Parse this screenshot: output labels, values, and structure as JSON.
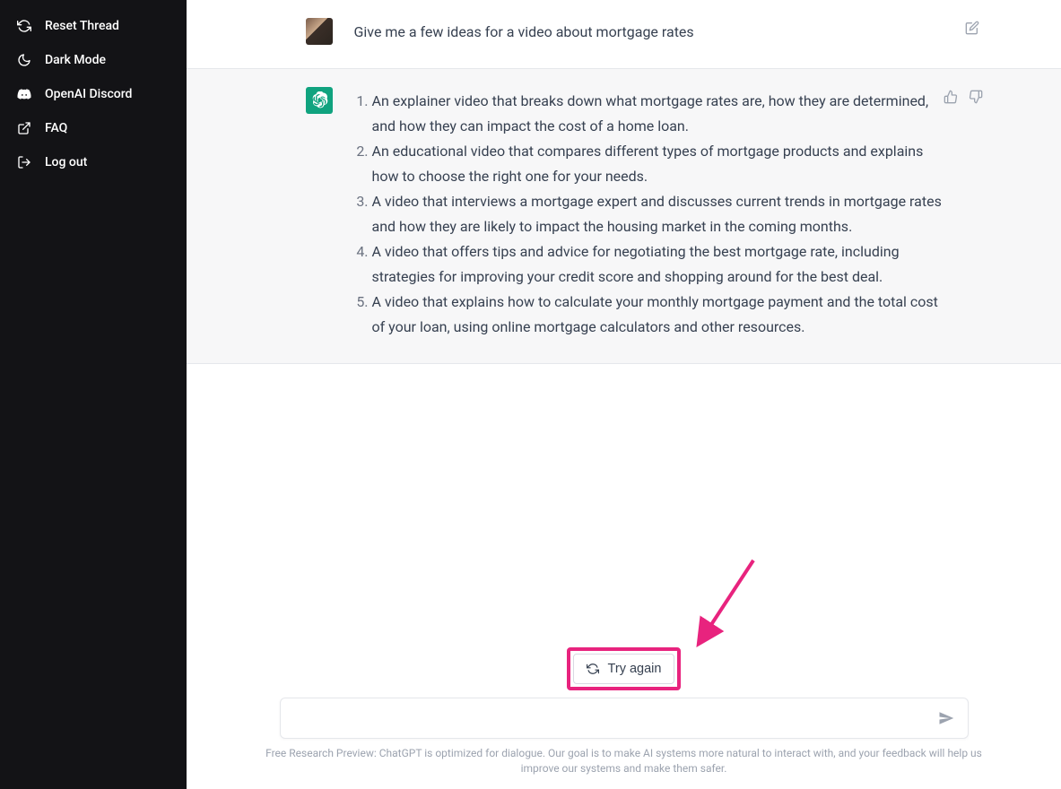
{
  "sidebar": {
    "items": [
      {
        "label": "Reset Thread"
      },
      {
        "label": "Dark Mode"
      },
      {
        "label": "OpenAI Discord"
      },
      {
        "label": "FAQ"
      },
      {
        "label": "Log out"
      }
    ]
  },
  "conversation": {
    "user_message": "Give me a few ideas for a video about mortgage rates",
    "assistant_items": [
      "An explainer video that breaks down what mortgage rates are, how they are determined, and how they can impact the cost of a home loan.",
      "An educational video that compares different types of mortgage products and explains how to choose the right one for your needs.",
      "A video that interviews a mortgage expert and discusses current trends in mortgage rates and how they are likely to impact the housing market in the coming months.",
      "A video that offers tips and advice for negotiating the best mortgage rate, including strategies for improving your credit score and shopping around for the best deal.",
      "A video that explains how to calculate your monthly mortgage payment and the total cost of your loan, using online mortgage calculators and other resources."
    ]
  },
  "footer": {
    "try_again_label": "Try again",
    "input_placeholder": "",
    "disclaimer": "Free Research Preview: ChatGPT is optimized for dialogue. Our goal is to make AI systems more natural to interact with, and your feedback will help us improve our systems and make them safer."
  },
  "annotation": {
    "arrow_color": "#e8237e"
  }
}
